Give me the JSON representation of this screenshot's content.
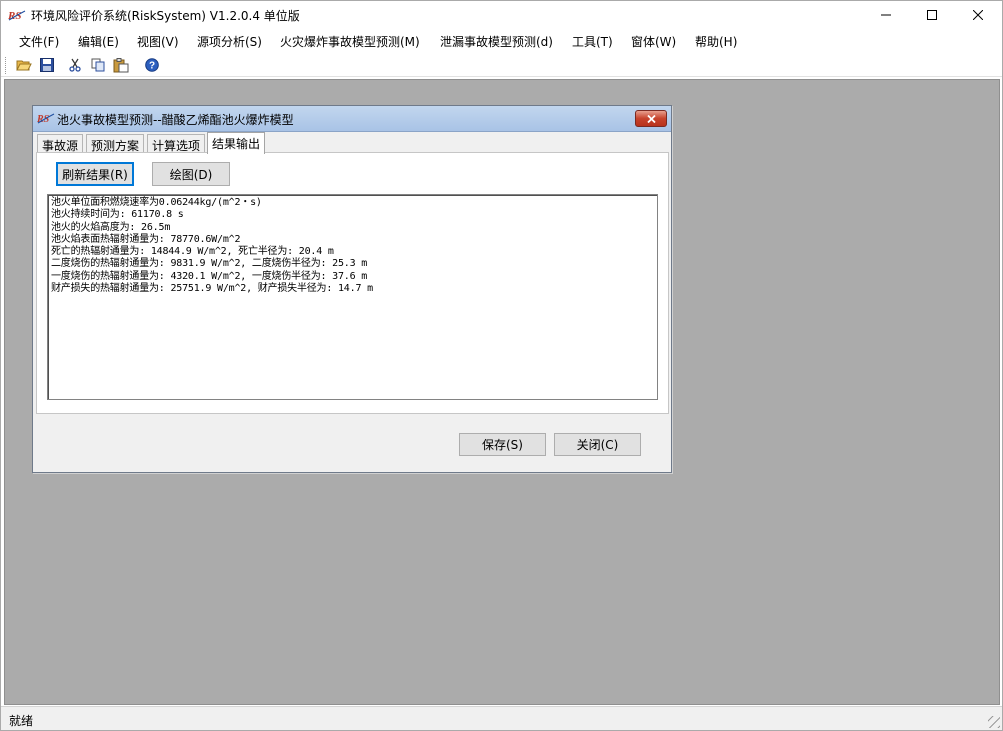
{
  "window": {
    "title": "环境风险评价系统(RiskSystem) V1.2.0.4 单位版",
    "controls": {
      "minimize_icon": "minimize-icon",
      "maximize_icon": "maximize-icon",
      "close_icon": "close-icon"
    }
  },
  "menubar": {
    "items": [
      {
        "label": "文件(F)"
      },
      {
        "label": "编辑(E)"
      },
      {
        "label": "视图(V)"
      },
      {
        "label": "源项分析(S)"
      },
      {
        "label": "火灾爆炸事故模型预测(M)"
      },
      {
        "label": "泄漏事故模型预测(d)"
      },
      {
        "label": "工具(T)"
      },
      {
        "label": "窗体(W)"
      },
      {
        "label": "帮助(H)"
      }
    ]
  },
  "toolbar": {
    "buttons": [
      "open-folder-icon",
      "save-disk-icon",
      "cut-icon",
      "copy-icon",
      "paste-icon",
      "help-icon"
    ]
  },
  "dialog": {
    "title": "池火事故模型预测--醋酸乙烯酯池火爆炸模型",
    "tabs": [
      {
        "label": "事故源",
        "active": false
      },
      {
        "label": "预测方案",
        "active": false
      },
      {
        "label": "计算选项",
        "active": false
      },
      {
        "label": "结果输出",
        "active": true
      }
    ],
    "refresh_button": "刷新结果(R)",
    "plot_button": "绘图(D)",
    "results": [
      "池火单位面积燃烧速率为0.06244kg/(m^2・s)",
      "池火持续时间为: 61170.8 s",
      "池火的火焰高度为: 26.5m",
      "池火焰表面热辐射通量为: 78770.6W/m^2",
      "死亡的热辐射通量为: 14844.9 W/m^2, 死亡半径为: 20.4 m",
      "二度烧伤的热辐射通量为: 9831.9 W/m^2, 二度烧伤半径为: 25.3 m",
      "一度烧伤的热辐射通量为: 4320.1 W/m^2, 一度烧伤半径为: 37.6 m",
      "财产损失的热辐射通量为: 25751.9 W/m^2, 财产损失半径为: 14.7 m"
    ],
    "save_button": "保存(S)",
    "close_button": "关闭(C)"
  },
  "statusbar": {
    "text": "就绪"
  },
  "colors": {
    "mdi_background": "#ababab",
    "dialog_titlebar": "#b4cbea",
    "dialog_close": "#c7432c",
    "focus_border": "#0078d7"
  }
}
